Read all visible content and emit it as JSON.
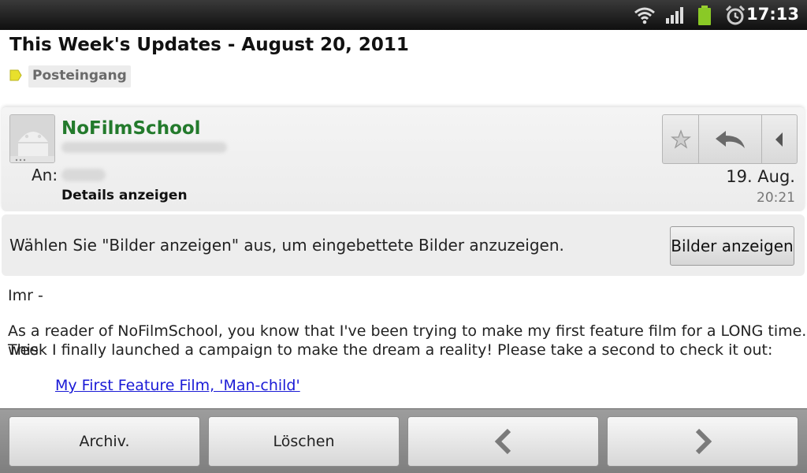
{
  "status_bar": {
    "time": "17:13",
    "icons": [
      "wifi-icon",
      "signal-icon",
      "battery-icon",
      "alarm-icon"
    ]
  },
  "header": {
    "subject": "This Week's Updates - August 20, 2011",
    "label": "Posteingang",
    "label_color": "#e8e02c"
  },
  "sender": {
    "name": "NoFilmSchool",
    "name_color": "#237a2c",
    "to_label": "An:",
    "details_link": "Details anzeigen",
    "date": "19. Aug.",
    "time": "20:21"
  },
  "images_banner": {
    "message": "Wählen Sie \"Bilder anzeigen\" aus, um eingebettete Bilder anzuzeigen.",
    "button_label": "Bilder anzeigen"
  },
  "body": {
    "greeting": "Imr -",
    "paragraph_line1": "As a reader of NoFilmSchool, you know that I've been trying to make my first feature film for a LONG time. This",
    "paragraph_line2": "week I finally launched a campaign to make the dream a reality! Please take a second to check it out:",
    "link_text": "My First Feature Film, 'Man-child'",
    "link_color": "#1a1ad6"
  },
  "toolbar": {
    "archive_label": "Archiv.",
    "delete_label": "Löschen",
    "prev_icon": "chevron-left-icon",
    "next_icon": "chevron-right-icon"
  }
}
